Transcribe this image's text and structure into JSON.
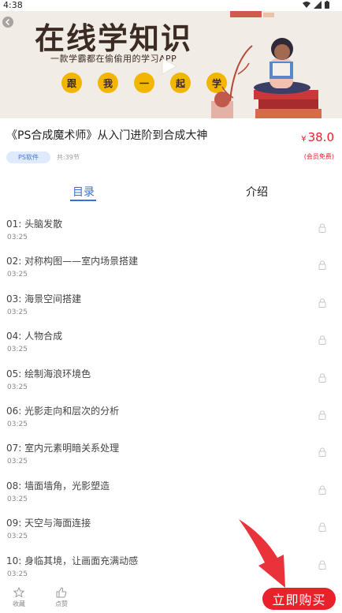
{
  "status_bar": {
    "time": "4:38"
  },
  "banner": {
    "title": "在线学知识",
    "subtitle": "一款学霸都在偷偷用的学习APP",
    "chars": [
      "跟",
      "我",
      "一",
      "起",
      "学"
    ]
  },
  "course": {
    "title": "《PS合成魔术师》从入门进阶到合成大神",
    "price_symbol": "¥",
    "price_value": "38.0",
    "member_note": "(会员免费)",
    "tag": "PS软件",
    "lesson_count": "共:39节"
  },
  "tabs": {
    "catalog": "目录",
    "intro": "介绍"
  },
  "lessons": [
    {
      "title": "01:  头脑发散",
      "time": "03:25"
    },
    {
      "title": "02:  对称构图——室内场景搭建",
      "time": "03:25"
    },
    {
      "title": "03:  海景空间搭建",
      "time": "03:25"
    },
    {
      "title": "04:  人物合成",
      "time": "03:25"
    },
    {
      "title": "05:  绘制海浪环境色",
      "time": "03:25"
    },
    {
      "title": "06:  光影走向和层次的分析",
      "time": "03:25"
    },
    {
      "title": "07:  室内元素明暗关系处理",
      "time": "03:25"
    },
    {
      "title": "08:  墙面墙角，光影塑造",
      "time": "03:25"
    },
    {
      "title": "09:  天空与海面连接",
      "time": "03:25"
    },
    {
      "title": "10:  身临其境，让画面充满动感",
      "time": "03:25"
    }
  ],
  "bottom_bar": {
    "favorite": "收藏",
    "like": "点赞",
    "buy": "立即购买"
  },
  "colors": {
    "accent_red": "#e8212a",
    "accent_blue": "#3a6fd8",
    "tag_bg": "#dfeafb"
  }
}
